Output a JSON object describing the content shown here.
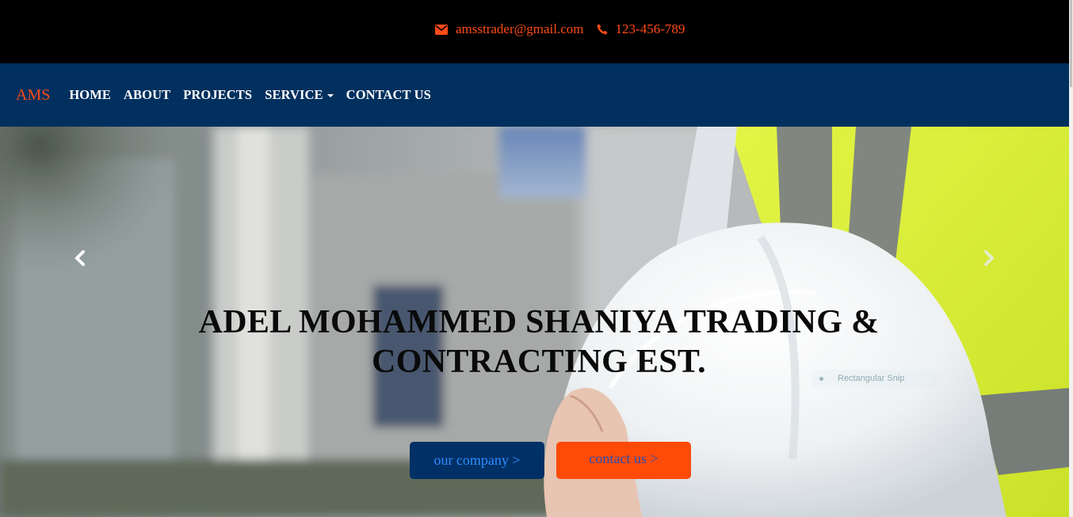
{
  "topbar": {
    "email": "amsstrader@gmail.com",
    "phone": "123-456-789",
    "email_icon": "envelope-icon",
    "phone_icon": "phone-icon"
  },
  "navbar": {
    "brand": "AMS",
    "links": [
      {
        "label": "HOME"
      },
      {
        "label": "ABOUT"
      },
      {
        "label": "PROJECTS"
      },
      {
        "label": "SERVICE",
        "has_dropdown": true
      },
      {
        "label": "CONTACT US"
      }
    ]
  },
  "hero": {
    "title_line1": "ADEL MOHAMMED SHANIYA TRADING &",
    "title_line2": "CONTRACTING EST.",
    "prev_icon": "chevron-left-icon",
    "next_icon": "chevron-right-icon",
    "button_company": "our company >",
    "button_contact": "contact us >",
    "overlay_label": "Rectangular Snip"
  },
  "colors": {
    "accent": "#ff4a16",
    "navbar_bg": "#01305e",
    "topbar_bg": "#000000",
    "vest_yellow": "#d8ef2a"
  }
}
